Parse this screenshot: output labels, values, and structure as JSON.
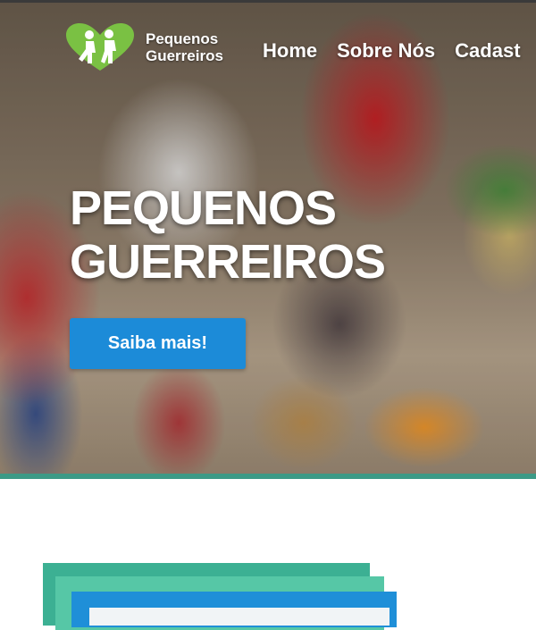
{
  "header": {
    "logo_icon": "two-children-heart-logo",
    "brand_line1": "Pequenos",
    "brand_line2": "Guerreiros",
    "nav": [
      {
        "label": "Home"
      },
      {
        "label": "Sobre Nós"
      },
      {
        "label": "Cadast"
      }
    ]
  },
  "hero": {
    "title_line1": "PEQUENOS",
    "title_line2": "GUERREIROS",
    "cta_label": "Saiba mais!"
  },
  "colors": {
    "accent_teal": "#3c9a86",
    "cta_blue": "#1c8bd8",
    "logo_green": "#7ac143"
  }
}
